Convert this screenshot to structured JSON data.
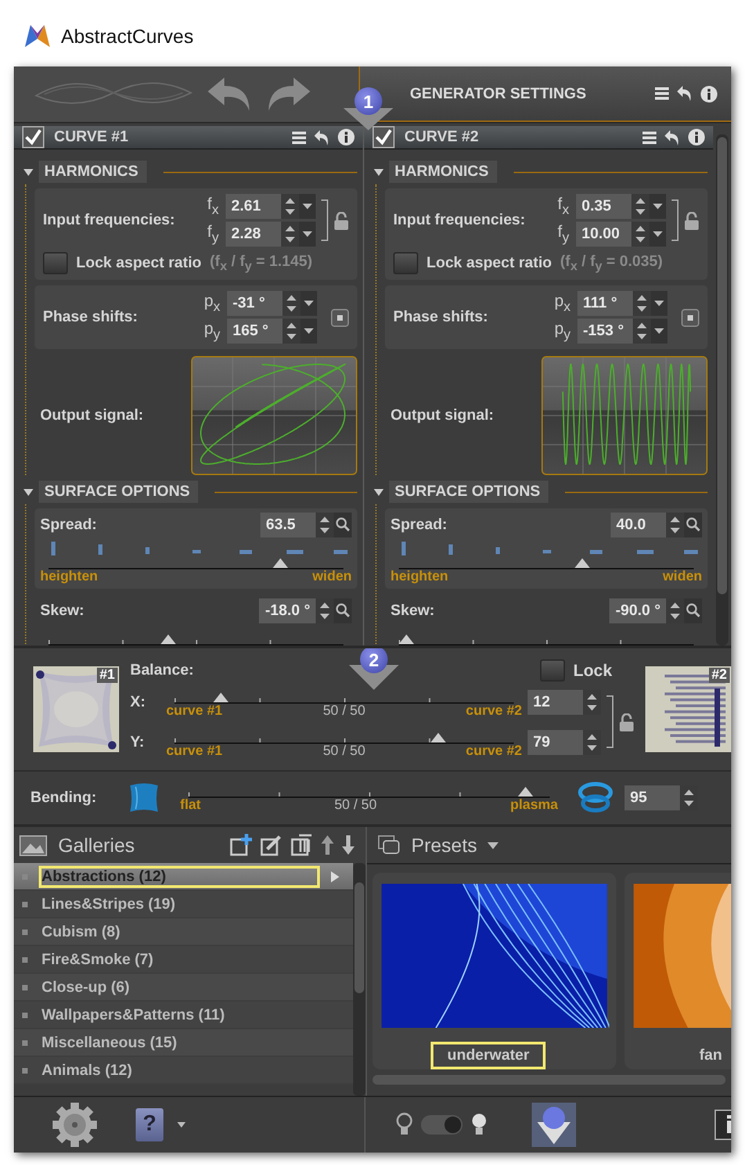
{
  "window": {
    "title": "AbstractCurves"
  },
  "toolbar": {
    "panel_title": "GENERATOR SETTINGS",
    "callout": "1"
  },
  "curves": [
    {
      "title": "CURVE #1",
      "enabled": true,
      "harmonics_title": "HARMONICS",
      "input_label": "Input frequencies:",
      "frequencies": [
        {
          "label": "f$_{x}$",
          "value": "2.61"
        },
        {
          "label": "f$_{y}$",
          "value": "2.28"
        }
      ],
      "lock_ratio": {
        "label": "Lock aspect ratio",
        "checked": false,
        "ratio": "(f$_{x}$ / f$_{y}$ = 1.145)"
      },
      "phase_label": "Phase shifts:",
      "phases": [
        {
          "label": "p$_{x}$",
          "value": "-31 °"
        },
        {
          "label": "p$_{y}$",
          "value": "165 °"
        }
      ],
      "output_label": "Output signal:",
      "surface_title": "SURFACE OPTIONS",
      "spread": {
        "label": "Spread:",
        "value": "63.5",
        "level": 0.8,
        "min_label": "heighten",
        "max_label": "widen"
      },
      "skew": {
        "label": "Skew:",
        "value": "-18.0 °",
        "level": 0.4
      }
    },
    {
      "title": "CURVE #2",
      "enabled": true,
      "harmonics_title": "HARMONICS",
      "input_label": "Input frequencies:",
      "frequencies": [
        {
          "label": "f$_{x}$",
          "value": "0.35"
        },
        {
          "label": "f$_{y}$",
          "value": "10.00"
        }
      ],
      "lock_ratio": {
        "label": "Lock aspect ratio",
        "checked": false,
        "ratio": "(f$_{x}$ / f$_{y}$ = 0.035)"
      },
      "phase_label": "Phase shifts:",
      "phases": [
        {
          "label": "p$_{x}$",
          "value": "111 °"
        },
        {
          "label": "p$_{y}$",
          "value": "-153 °"
        }
      ],
      "output_label": "Output signal:",
      "surface_title": "SURFACE OPTIONS",
      "spread": {
        "label": "Spread:",
        "value": "40.0",
        "level": 0.63,
        "min_label": "heighten",
        "max_label": "widen"
      },
      "skew": {
        "label": "Skew:",
        "value": "-90.0 °",
        "level": 0
      }
    }
  ],
  "balance": {
    "label": "Balance:",
    "callout": "2",
    "lock": {
      "label": "Lock",
      "checked": false
    },
    "preview_1": "#1",
    "preview_2": "#2",
    "axes": [
      {
        "label": "X:",
        "level": 0.12,
        "min_label": "curve #1",
        "mid_label": "50 / 50",
        "max_label": "curve #2",
        "value": "12"
      },
      {
        "label": "Y:",
        "level": 0.79,
        "min_label": "curve #1",
        "mid_label": "50 / 50",
        "max_label": "curve #2",
        "value": "79"
      }
    ]
  },
  "bending": {
    "label": "Bending:",
    "min_label": "flat",
    "mid_label": "50 / 50",
    "max_label": "plasma",
    "level": 0.95,
    "value": "95"
  },
  "galleries": {
    "title": "Galleries",
    "items": [
      {
        "label": "Abstractions (12)",
        "selected": true,
        "highlighted": true
      },
      {
        "label": "Lines&Stripes (19)",
        "selected": false,
        "highlighted": false
      },
      {
        "label": "Cubism (8)",
        "selected": false,
        "highlighted": false
      },
      {
        "label": "Fire&Smoke (7)",
        "selected": false,
        "highlighted": false
      },
      {
        "label": "Close-up (6)",
        "selected": false,
        "highlighted": false
      },
      {
        "label": "Wallpapers&Patterns (11)",
        "selected": false,
        "highlighted": false
      },
      {
        "label": "Miscellaneous (15)",
        "selected": false,
        "highlighted": false
      },
      {
        "label": "Animals (12)",
        "selected": false,
        "highlighted": false
      }
    ]
  },
  "presets": {
    "title": "Presets",
    "items": [
      {
        "kind": "picture",
        "caption": "underwater",
        "highlighted": true
      },
      {
        "kind": "picture",
        "caption": "fan",
        "highlighted": false
      }
    ]
  },
  "bottom_bar": {
    "help_label": "?",
    "light_toggle": {
      "on": true
    }
  }
}
